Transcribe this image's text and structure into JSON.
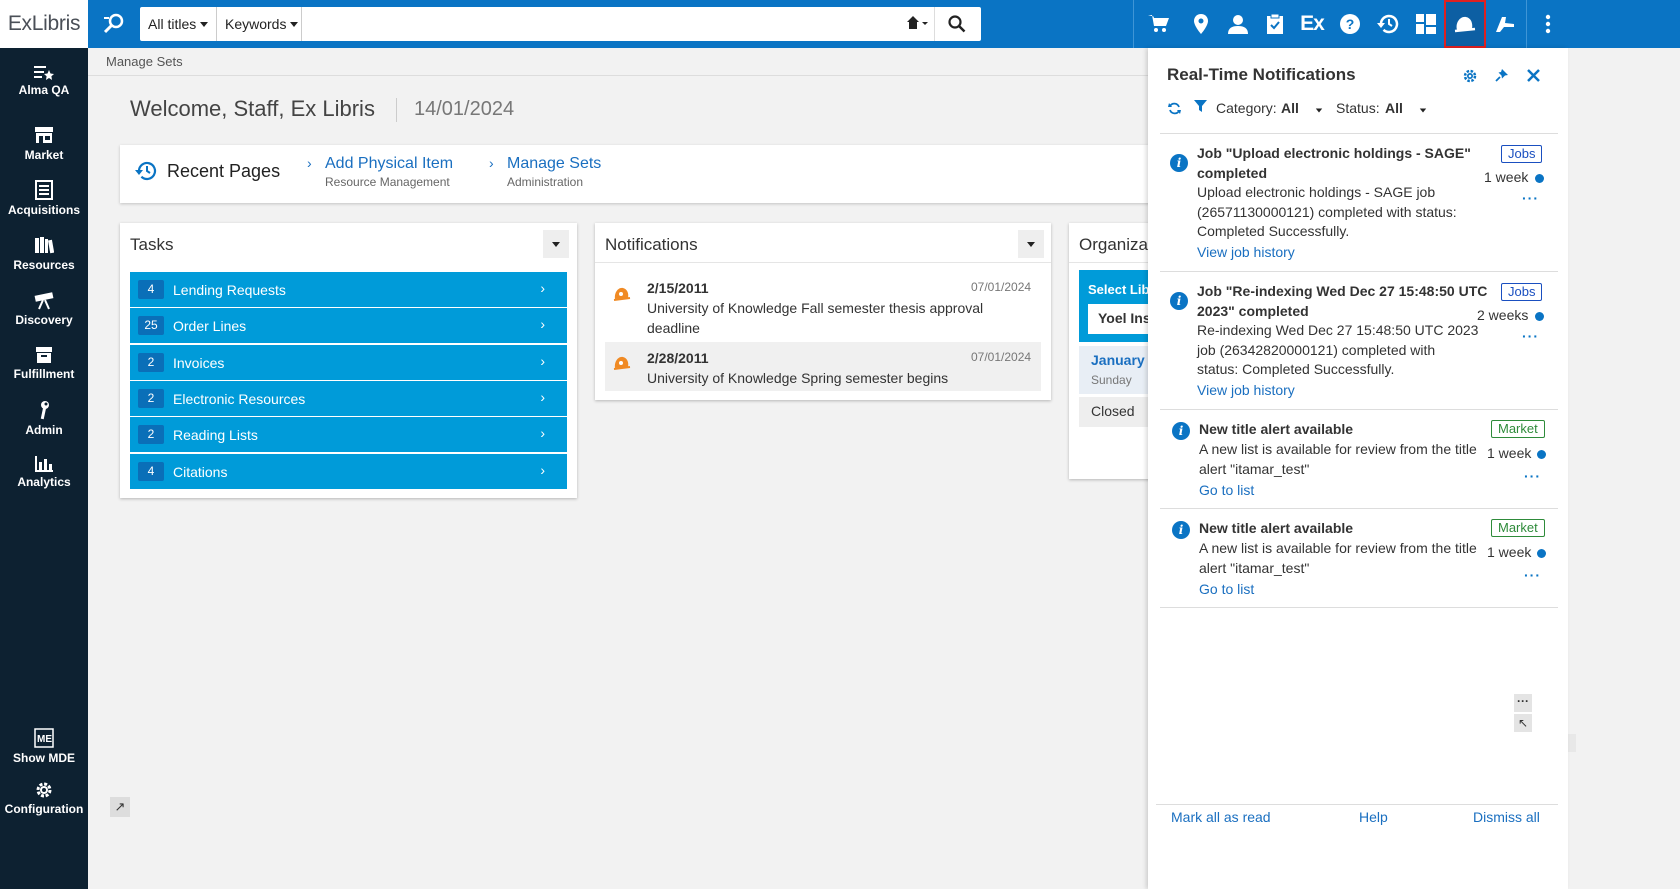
{
  "app": {
    "logo_text_a": "Ex",
    "logo_text_b": "Libris"
  },
  "sidebar": {
    "items": [
      {
        "label": "Alma QA",
        "icon": "menu-star-icon"
      },
      {
        "label": "Market",
        "icon": "store-icon"
      },
      {
        "label": "Acquisitions",
        "icon": "ledger-icon"
      },
      {
        "label": "Resources",
        "icon": "books-icon"
      },
      {
        "label": "Discovery",
        "icon": "telescope-icon"
      },
      {
        "label": "Fulfillment",
        "icon": "box-icon"
      },
      {
        "label": "Admin",
        "icon": "wrench-icon"
      },
      {
        "label": "Analytics",
        "icon": "bar-chart-icon"
      },
      {
        "label": "Show MDE",
        "icon": "mde-icon"
      },
      {
        "label": "Configuration",
        "icon": "gear-icon"
      }
    ]
  },
  "search": {
    "scope": "All titles",
    "field": "Keywords",
    "placeholder": ""
  },
  "breadcrumb": "Manage Sets",
  "welcome": {
    "text": "Welcome, Staff, Ex Libris",
    "date": "14/01/2024"
  },
  "recent_pages": {
    "title": "Recent Pages",
    "items": [
      {
        "label": "Add Physical Item",
        "sub": "Resource Management"
      },
      {
        "label": "Manage Sets",
        "sub": "Administration"
      }
    ]
  },
  "tasks": {
    "title": "Tasks",
    "rows": [
      {
        "count": "4",
        "label": "Lending Requests"
      },
      {
        "count": "25",
        "label": "Order Lines"
      },
      {
        "count": "2",
        "label": "Invoices"
      },
      {
        "count": "2",
        "label": "Electronic Resources"
      },
      {
        "count": "2",
        "label": "Reading Lists"
      },
      {
        "count": "4",
        "label": "Citations"
      }
    ]
  },
  "notifications": {
    "title": "Notifications",
    "items": [
      {
        "date": "2/15/2011",
        "posted": "07/01/2024",
        "text_1": "University of Knowledge Fall semester thesis approval",
        "text_2": "deadline"
      },
      {
        "date": "2/28/2011",
        "posted": "07/01/2024",
        "text_1": "University of Knowledge Spring semester begins",
        "text_2": ""
      }
    ]
  },
  "organization": {
    "title": "Organizat",
    "select_label": "Select Libr",
    "library": "Yoel Inst",
    "month": "January",
    "weekday": "Sunday",
    "status": "Closed"
  },
  "rtn": {
    "title": "Real-Time Notifications",
    "category_label": "Category:",
    "category_value": "All",
    "status_label": "Status:",
    "status_value": "All",
    "entries": [
      {
        "title_1": "Job \"Upload electronic holdings - SAGE\"",
        "title_2": "completed",
        "body_1": "Upload electronic holdings - SAGE job",
        "body_2": "(26571130000121) completed with status:",
        "body_3": "Completed Successfully.",
        "link": "View job history",
        "badge": "Jobs",
        "age": "1 week"
      },
      {
        "title_1": "Job \"Re-indexing Wed Dec 27 15:48:50 UTC",
        "title_2": "2023\" completed",
        "body_1": "Re-indexing Wed Dec 27 15:48:50 UTC 2023",
        "body_2": "job (26342820000121) completed with",
        "body_3": "status: Completed Successfully.",
        "link": "View job history",
        "badge": "Jobs",
        "age": "2 weeks"
      },
      {
        "title_1": "New title alert available",
        "body_1": "A new list is available for review from the title",
        "body_2": "alert \"itamar_test\"",
        "link": "Go to list",
        "badge": "Market",
        "age": "1 week"
      },
      {
        "title_1": "New title alert available",
        "body_1": "A new list is available for review from the title",
        "body_2": "alert \"itamar_test\"",
        "link": "Go to list",
        "badge": "Market",
        "age": "1 week"
      }
    ],
    "footer": {
      "mark_all": "Mark all as read",
      "help": "Help",
      "dismiss": "Dismiss all"
    }
  },
  "colors": {
    "topbar": "#0a74c4",
    "sidebar": "#0d2131",
    "task_row": "#009bd9",
    "highlight": "#e02020"
  }
}
